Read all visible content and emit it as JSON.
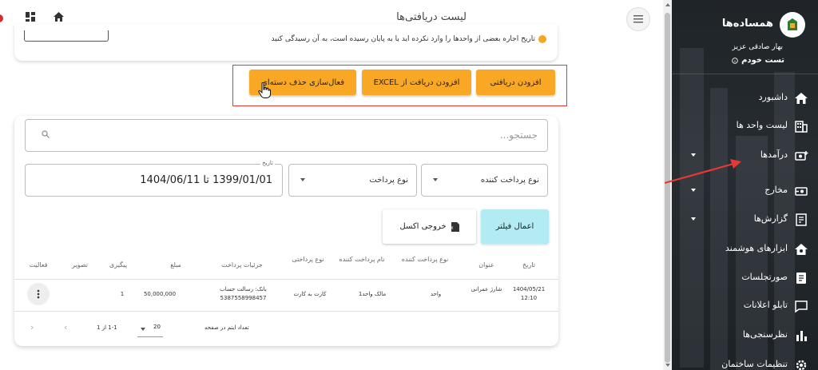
{
  "header": {
    "title": "لیست دریافتی‌ها"
  },
  "alert": {
    "text": "تاریخ اجاره بعضی از واحدها را وارد نکرده اید یا به پایان رسیده است، به آن رسیدگی کنید"
  },
  "actions": {
    "add_receipt": "افزودن دریافتی",
    "add_excel": "افزودن دریافت از EXCEL",
    "bulk_delete": "فعال‌سازی حذف دسته‌ای"
  },
  "filters": {
    "search_placeholder": "جستجو...",
    "payer_type": "نوع پرداخت کننده",
    "payment_type": "نوع پرداخت",
    "date_label": "تاریخ",
    "date_range": "1399/01/01 تا 1404/06/11",
    "apply": "اعمال فیلتر",
    "export_excel": "خروجی اکسل"
  },
  "table": {
    "headers": {
      "date": "تاریخ",
      "title": "عنوان",
      "payer_type": "نوع پرداخت کننده",
      "payer_name": "نام پرداخت کننده",
      "payment_type": "نوع پرداختی",
      "payment_details": "جزئیات پرداخت",
      "amount": "مبلغ",
      "tracking": "پیگیری",
      "image": "تصویر",
      "activity": "فعالیت"
    },
    "rows": [
      {
        "date": "1404/05/21",
        "time": "12:10",
        "title": "شارژ عمرانی",
        "payer_type": "واحد",
        "payer_name": "مالک واحد1",
        "payment_type": "کارت به کارت",
        "details_line1": "بانک: رسالت حساب",
        "details_line2": "5387558998457",
        "amount": "50,000,000",
        "tracking": "1"
      }
    ]
  },
  "pagination": {
    "rows_per_page_label": "تعداد ایتم در صفحه",
    "rows_per_page": "20",
    "range": "1-1 از 1"
  },
  "sidebar": {
    "brand": "همساده‌ها",
    "user_name": "بهار صادقی عزیز",
    "building": "تست خودم",
    "items": [
      {
        "label": "داشبورد",
        "icon": "home-icon"
      },
      {
        "label": "لیست واحد ها",
        "icon": "building-icon"
      },
      {
        "label": "درآمدها",
        "icon": "income-icon"
      },
      {
        "label": "مخارج",
        "icon": "expense-icon"
      },
      {
        "label": "گزارش‌ها",
        "icon": "report-icon"
      },
      {
        "label": "ابزارهای هوشمند",
        "icon": "smart-home-icon"
      },
      {
        "label": "صورتجلسات",
        "icon": "minutes-icon"
      },
      {
        "label": "تابلو اعلانات",
        "icon": "announcement-icon"
      },
      {
        "label": "نظرسنجی‌ها",
        "icon": "poll-icon"
      },
      {
        "label": "تنظیمات ساختمان",
        "icon": "settings-icon"
      }
    ]
  },
  "colors": {
    "accent_orange": "#f9a825",
    "apply_cyan": "#b2ebf2",
    "highlight_red": "#e53935",
    "sidebar_dark": "#22272b"
  }
}
